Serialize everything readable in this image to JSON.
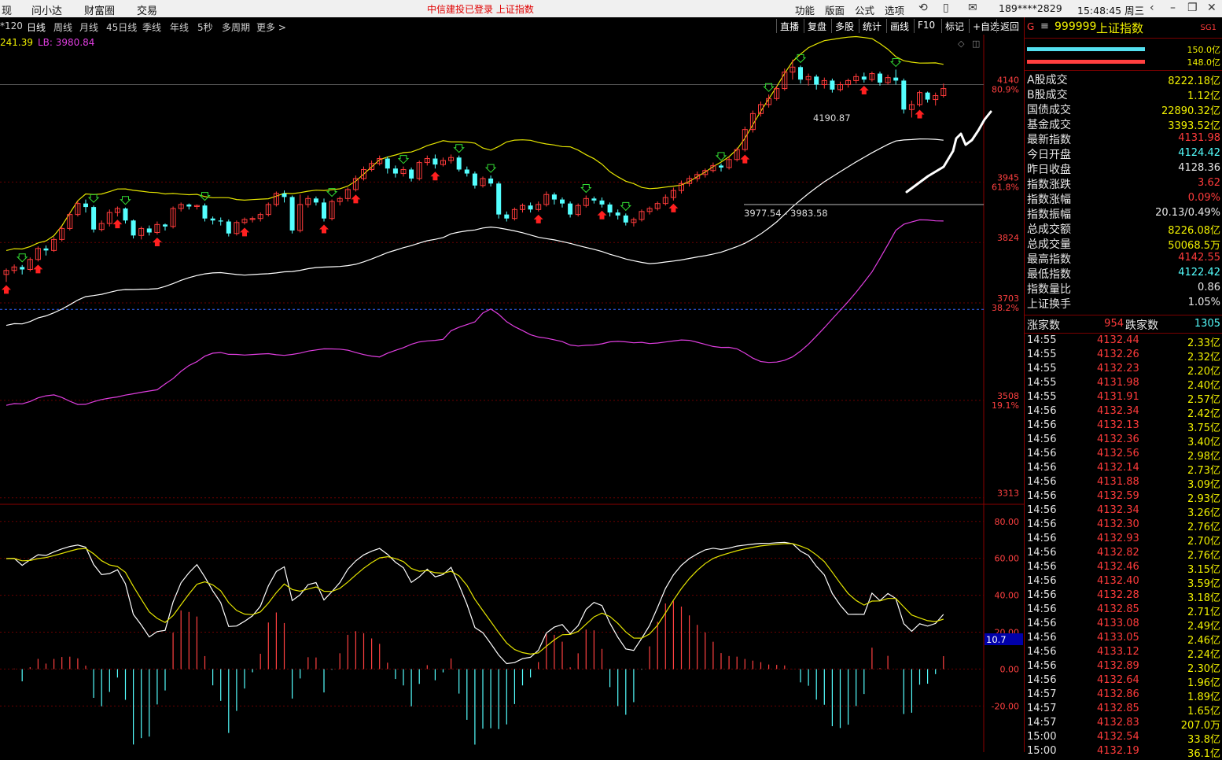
{
  "menu_left": [
    "现",
    "问小达",
    "财富圈",
    "交易"
  ],
  "status_center": "中信建投已登录  上证指数",
  "menu_right": [
    "功能",
    "版面",
    "公式",
    "选项"
  ],
  "user": "189****2829",
  "clock": "15:48:45 周三",
  "periods": [
    "*120",
    "日线",
    "周线",
    "月线",
    "45日线",
    "季线",
    "年线",
    "5秒",
    "多周期",
    "更多 >"
  ],
  "active_period": "日线",
  "toolbar": [
    "直播",
    "复盘",
    "多股",
    "统计",
    "画线",
    "F10",
    "标记",
    "+自选",
    "返回"
  ],
  "indicator_legend": {
    "ub": "241.39",
    "lb": "LB: 3980.84"
  },
  "price_axis": [
    {
      "price": "4140",
      "pct": "80.9%"
    },
    {
      "price": "3945",
      "pct": "61.8%"
    },
    {
      "price": "3824",
      "pct": ""
    },
    {
      "price": "3703",
      "pct": "38.2%"
    },
    {
      "price": "3508",
      "pct": "19.1%"
    },
    {
      "price": "3313",
      "pct": ""
    }
  ],
  "osc_axis": [
    "80.00",
    "60.00",
    "40.00",
    "20.00",
    "0.00",
    "-20.00"
  ],
  "osc_marker": "10.7",
  "annotations": {
    "high": "4190.87",
    "range": "3977.54 - 3983.58"
  },
  "colors": {
    "up": "#ff3b3b",
    "down": "#54ffff",
    "ma_yellow": "#e5e500",
    "ma_white": "#ffffff",
    "ma_magenta": "#e03ee0",
    "bg": "#000000"
  },
  "panel": {
    "code": "999999",
    "name": "上证指数",
    "tag": "SG1",
    "bars": [
      "150.0亿",
      "148.0亿"
    ],
    "stats": [
      {
        "k": "A股成交",
        "v": "8222.18亿",
        "c": "#f0f000"
      },
      {
        "k": "B股成交",
        "v": "1.12亿",
        "c": "#f0f000"
      },
      {
        "k": "国债成交",
        "v": "22890.32亿",
        "c": "#f0f000"
      },
      {
        "k": "基金成交",
        "v": "3393.52亿",
        "c": "#f0f000"
      },
      {
        "k": "最新指数",
        "v": "4131.98",
        "c": "#ff3b3b"
      },
      {
        "k": "今日开盘",
        "v": "4124.42",
        "c": "#54ffff"
      },
      {
        "k": "昨日收盘",
        "v": "4128.36",
        "c": "#e8e8e8"
      },
      {
        "k": "指数涨跌",
        "v": "3.62",
        "c": "#ff3b3b"
      },
      {
        "k": "指数涨幅",
        "v": "0.09%",
        "c": "#ff3b3b"
      },
      {
        "k": "指数振幅",
        "v": "20.13/0.49%",
        "c": "#e8e8e8"
      },
      {
        "k": "总成交额",
        "v": "8226.08亿",
        "c": "#f0f000"
      },
      {
        "k": "总成交量",
        "v": "50068.5万",
        "c": "#f0f000"
      },
      {
        "k": "最高指数",
        "v": "4142.55",
        "c": "#ff3b3b"
      },
      {
        "k": "最低指数",
        "v": "4122.42",
        "c": "#54ffff"
      },
      {
        "k": "指数量比",
        "v": "0.86",
        "c": "#e8e8e8"
      },
      {
        "k": "上证换手",
        "v": "1.05%",
        "c": "#e8e8e8"
      }
    ],
    "rise_label": "涨家数",
    "rise_count": "954",
    "fall_label": "跌家数",
    "fall_count": "1305",
    "ticks": [
      {
        "t": "14:55",
        "p": "4132.44",
        "v": "2.33亿"
      },
      {
        "t": "14:55",
        "p": "4132.26",
        "v": "2.32亿"
      },
      {
        "t": "14:55",
        "p": "4132.23",
        "v": "2.20亿"
      },
      {
        "t": "14:55",
        "p": "4131.98",
        "v": "2.40亿"
      },
      {
        "t": "14:55",
        "p": "4131.91",
        "v": "2.57亿"
      },
      {
        "t": "14:56",
        "p": "4132.34",
        "v": "2.42亿"
      },
      {
        "t": "14:56",
        "p": "4132.13",
        "v": "3.75亿"
      },
      {
        "t": "14:56",
        "p": "4132.36",
        "v": "3.40亿"
      },
      {
        "t": "14:56",
        "p": "4132.56",
        "v": "2.98亿"
      },
      {
        "t": "14:56",
        "p": "4132.14",
        "v": "2.73亿"
      },
      {
        "t": "14:56",
        "p": "4131.88",
        "v": "3.09亿"
      },
      {
        "t": "14:56",
        "p": "4132.59",
        "v": "2.93亿"
      },
      {
        "t": "14:56",
        "p": "4132.34",
        "v": "3.26亿"
      },
      {
        "t": "14:56",
        "p": "4132.30",
        "v": "2.76亿"
      },
      {
        "t": "14:56",
        "p": "4132.93",
        "v": "2.70亿"
      },
      {
        "t": "14:56",
        "p": "4132.82",
        "v": "2.76亿"
      },
      {
        "t": "14:56",
        "p": "4132.46",
        "v": "3.15亿"
      },
      {
        "t": "14:56",
        "p": "4132.40",
        "v": "3.59亿"
      },
      {
        "t": "14:56",
        "p": "4132.28",
        "v": "3.18亿"
      },
      {
        "t": "14:56",
        "p": "4132.85",
        "v": "2.71亿"
      },
      {
        "t": "14:56",
        "p": "4133.08",
        "v": "2.49亿"
      },
      {
        "t": "14:56",
        "p": "4133.05",
        "v": "2.46亿"
      },
      {
        "t": "14:56",
        "p": "4133.12",
        "v": "2.24亿"
      },
      {
        "t": "14:56",
        "p": "4132.89",
        "v": "2.30亿"
      },
      {
        "t": "14:56",
        "p": "4132.64",
        "v": "1.96亿"
      },
      {
        "t": "14:57",
        "p": "4132.86",
        "v": "1.89亿"
      },
      {
        "t": "14:57",
        "p": "4132.85",
        "v": "1.65亿"
      },
      {
        "t": "14:57",
        "p": "4132.83",
        "v": "207.0万"
      },
      {
        "t": "15:00",
        "p": "4132.54",
        "v": "33.8亿"
      },
      {
        "t": "15:00",
        "p": "4132.19",
        "v": "36.1亿"
      }
    ]
  },
  "chart_data": {
    "type": "candlestick",
    "candles": [
      [
        3760,
        3768,
        3745,
        3772
      ],
      [
        3768,
        3775,
        3762,
        3780
      ],
      [
        3775,
        3770,
        3760,
        3779
      ],
      [
        3770,
        3790,
        3766,
        3794
      ],
      [
        3790,
        3812,
        3786,
        3816
      ],
      [
        3812,
        3808,
        3798,
        3818
      ],
      [
        3808,
        3830,
        3805,
        3835
      ],
      [
        3830,
        3852,
        3826,
        3857
      ],
      [
        3852,
        3880,
        3848,
        3885
      ],
      [
        3880,
        3902,
        3876,
        3908
      ],
      [
        3902,
        3895,
        3884,
        3910
      ],
      [
        3895,
        3850,
        3844,
        3898
      ],
      [
        3850,
        3862,
        3846,
        3868
      ],
      [
        3862,
        3884,
        3856,
        3890
      ],
      [
        3884,
        3892,
        3876,
        3896
      ],
      [
        3892,
        3868,
        3862,
        3894
      ],
      [
        3868,
        3838,
        3832,
        3870
      ],
      [
        3838,
        3852,
        3830,
        3856
      ],
      [
        3852,
        3844,
        3838,
        3858
      ],
      [
        3844,
        3860,
        3840,
        3866
      ],
      [
        3860,
        3856,
        3848,
        3862
      ],
      [
        3856,
        3892,
        3852,
        3896
      ],
      [
        3892,
        3900,
        3886,
        3904
      ],
      [
        3900,
        3896,
        3890,
        3902
      ],
      [
        3896,
        3898,
        3890,
        3900
      ],
      [
        3898,
        3872,
        3866,
        3902
      ],
      [
        3872,
        3868,
        3860,
        3876
      ],
      [
        3868,
        3866,
        3858,
        3874
      ],
      [
        3866,
        3842,
        3836,
        3870
      ],
      [
        3842,
        3864,
        3838,
        3868
      ],
      [
        3864,
        3870,
        3860,
        3874
      ],
      [
        3870,
        3872,
        3864,
        3876
      ],
      [
        3872,
        3880,
        3866,
        3884
      ],
      [
        3880,
        3900,
        3876,
        3904
      ],
      [
        3900,
        3922,
        3896,
        3926
      ],
      [
        3922,
        3915,
        3904,
        3928
      ],
      [
        3915,
        3848,
        3842,
        3918
      ],
      [
        3848,
        3900,
        3844,
        3920
      ],
      [
        3900,
        3912,
        3894,
        3918
      ],
      [
        3912,
        3904,
        3898,
        3916
      ],
      [
        3904,
        3872,
        3866,
        3912
      ],
      [
        3872,
        3906,
        3868,
        3910
      ],
      [
        3906,
        3912,
        3898,
        3916
      ],
      [
        3912,
        3930,
        3906,
        3934
      ],
      [
        3930,
        3952,
        3926,
        3958
      ],
      [
        3952,
        3970,
        3948,
        3976
      ],
      [
        3970,
        3982,
        3966,
        3988
      ],
      [
        3982,
        3992,
        3978,
        3998
      ],
      [
        3992,
        3972,
        3962,
        3996
      ],
      [
        3972,
        3962,
        3954,
        3978
      ],
      [
        3962,
        3970,
        3956,
        3976
      ],
      [
        3970,
        3952,
        3946,
        3974
      ],
      [
        3952,
        3984,
        3948,
        3988
      ],
      [
        3984,
        3992,
        3978,
        3998
      ],
      [
        3992,
        3980,
        3972,
        4000
      ],
      [
        3980,
        3988,
        3976,
        3994
      ],
      [
        3988,
        3994,
        3982,
        4000
      ],
      [
        3994,
        3970,
        3966,
        3998
      ],
      [
        3970,
        3962,
        3956,
        3976
      ],
      [
        3962,
        3938,
        3932,
        3966
      ],
      [
        3938,
        3952,
        3934,
        3956
      ],
      [
        3952,
        3942,
        3936,
        3958
      ],
      [
        3942,
        3880,
        3872,
        3946
      ],
      [
        3880,
        3872,
        3866,
        3886
      ],
      [
        3872,
        3890,
        3868,
        3894
      ],
      [
        3890,
        3898,
        3884,
        3902
      ],
      [
        3898,
        3890,
        3884,
        3904
      ],
      [
        3890,
        3900,
        3886,
        3906
      ],
      [
        3900,
        3920,
        3896,
        3926
      ],
      [
        3920,
        3910,
        3900,
        3924
      ],
      [
        3910,
        3902,
        3894,
        3914
      ],
      [
        3902,
        3880,
        3874,
        3906
      ],
      [
        3880,
        3898,
        3876,
        3902
      ],
      [
        3898,
        3912,
        3894,
        3918
      ],
      [
        3912,
        3908,
        3902,
        3916
      ],
      [
        3908,
        3900,
        3894,
        3914
      ],
      [
        3900,
        3884,
        3876,
        3904
      ],
      [
        3884,
        3878,
        3870,
        3890
      ],
      [
        3878,
        3864,
        3858,
        3882
      ],
      [
        3864,
        3870,
        3856,
        3874
      ],
      [
        3870,
        3886,
        3866,
        3890
      ],
      [
        3886,
        3892,
        3880,
        3896
      ],
      [
        3892,
        3902,
        3888,
        3906
      ],
      [
        3902,
        3914,
        3898,
        3920
      ],
      [
        3914,
        3928,
        3908,
        3934
      ],
      [
        3928,
        3942,
        3922,
        3948
      ],
      [
        3942,
        3952,
        3936,
        3958
      ],
      [
        3952,
        3960,
        3946,
        3966
      ],
      [
        3960,
        3968,
        3954,
        3972
      ],
      [
        3968,
        3978,
        3964,
        3984
      ],
      [
        3978,
        3974,
        3966,
        3982
      ],
      [
        3974,
        3990,
        3970,
        3996
      ],
      [
        3990,
        4010,
        3986,
        4014
      ],
      [
        4010,
        4050,
        4006,
        4056
      ],
      [
        4050,
        4082,
        4044,
        4088
      ],
      [
        4082,
        4100,
        4076,
        4106
      ],
      [
        4100,
        4112,
        4094,
        4120
      ],
      [
        4112,
        4132,
        4108,
        4138
      ],
      [
        4132,
        4165,
        4128,
        4172
      ],
      [
        4165,
        4175,
        4150,
        4190
      ],
      [
        4175,
        4150,
        4142,
        4178
      ],
      [
        4150,
        4156,
        4138,
        4162
      ],
      [
        4156,
        4140,
        4130,
        4160
      ],
      [
        4140,
        4148,
        4132,
        4154
      ],
      [
        4148,
        4130,
        4124,
        4152
      ],
      [
        4130,
        4140,
        4126,
        4146
      ],
      [
        4140,
        4148,
        4134,
        4152
      ],
      [
        4148,
        4156,
        4142,
        4162
      ],
      [
        4156,
        4150,
        4144,
        4164
      ],
      [
        4150,
        4162,
        4146,
        4166
      ],
      [
        4162,
        4144,
        4138,
        4166
      ],
      [
        4144,
        4154,
        4140,
        4160
      ],
      [
        4154,
        4148,
        4140,
        4170
      ],
      [
        4148,
        4090,
        4082,
        4152
      ],
      [
        4090,
        4100,
        4074,
        4108
      ],
      [
        4100,
        4124,
        4096,
        4128
      ],
      [
        4124,
        4110,
        4104,
        4126
      ],
      [
        4110,
        4118,
        4098,
        4124
      ],
      [
        4118,
        4132,
        4114,
        4142
      ]
    ],
    "ylim": [
      3300,
      4240
    ],
    "osc_range": [
      -45,
      88
    ]
  }
}
